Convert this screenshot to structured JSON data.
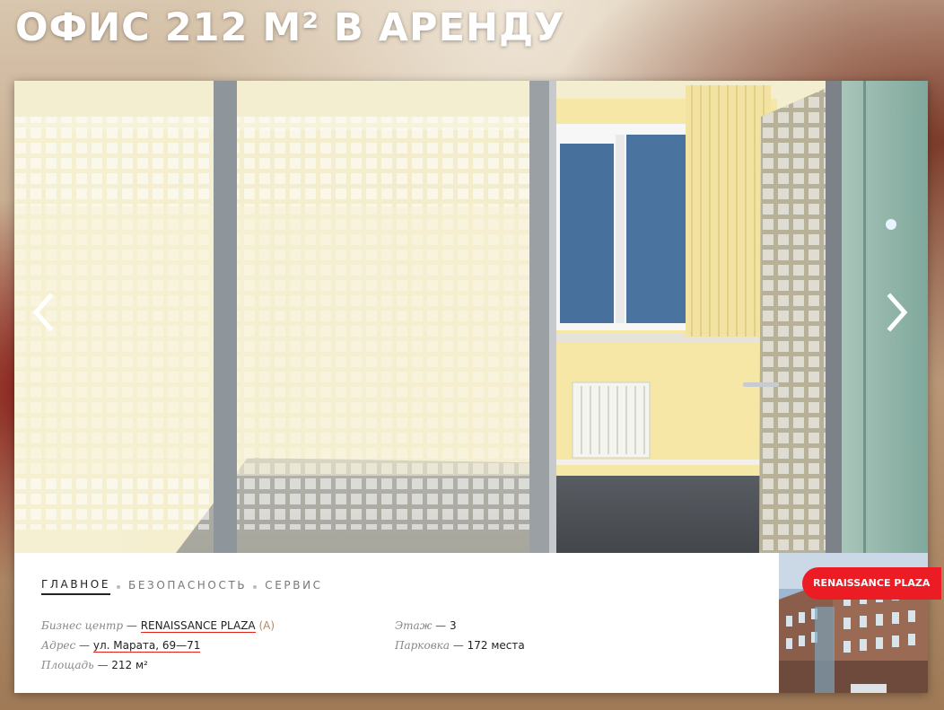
{
  "page": {
    "title": "ОФИС 212 М² В АРЕНДУ"
  },
  "slider": {
    "photo_icon": "office-interior-photo",
    "prev_icon": "chevron-left-icon",
    "next_icon": "chevron-right-icon"
  },
  "tabs": [
    {
      "label": "ГЛАВНОЕ",
      "active": true
    },
    {
      "label": "БЕЗОПАСНОСТЬ",
      "active": false
    },
    {
      "label": "СЕРВИС",
      "active": false
    }
  ],
  "details": {
    "business_center": {
      "label": "Бизнес центр",
      "sep": " — ",
      "value": "RENAISSANCE PLAZA",
      "class": " (А)"
    },
    "address": {
      "label": "Адрес",
      "sep": " — ",
      "value": "ул. Марата, 69—71"
    },
    "area": {
      "label": "Площадь",
      "sep": " — ",
      "value": "212 м²"
    },
    "floor": {
      "label": "Этаж",
      "sep": " — ",
      "value": "3"
    },
    "parking": {
      "label": "Парковка",
      "sep": " — ",
      "value": "172 места"
    }
  },
  "business_center_card": {
    "badge": "RENAISSANCE PLAZA",
    "photo_icon": "building-photo"
  },
  "colors": {
    "accent": "#ec1c24",
    "title": "#ffffff"
  }
}
